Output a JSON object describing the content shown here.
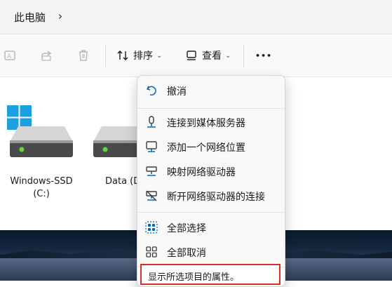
{
  "breadcrumb": {
    "location": "此电脑",
    "chevron": "›"
  },
  "toolbar": {
    "sort_label": "排序",
    "view_label": "查看",
    "more_label": "•••",
    "dropdown_chevron": "⌄"
  },
  "drives": [
    {
      "name": "Windows-SSD",
      "letter": "(C:)"
    },
    {
      "name": "Data (D"
    }
  ],
  "context_menu": {
    "items": [
      {
        "label": "撤消",
        "icon": "undo-icon"
      },
      {
        "label": "连接到媒体服务器",
        "icon": "media-server-icon"
      },
      {
        "label": "添加一个网络位置",
        "icon": "network-location-icon"
      },
      {
        "label": "映射网络驱动器",
        "icon": "map-drive-icon"
      },
      {
        "label": "断开网络驱动器的连接",
        "icon": "disconnect-drive-icon"
      },
      {
        "label": "全部选择",
        "icon": "select-all-icon"
      },
      {
        "label": "全部取消",
        "icon": "select-none-icon"
      }
    ]
  },
  "tooltip": {
    "text": "显示所选项目的属性。"
  },
  "colors": {
    "accent": "#0067c0",
    "windows_logo": "#1ba1e2",
    "drive_led": "#5fd83a",
    "tooltip_border": "#d9302c"
  }
}
